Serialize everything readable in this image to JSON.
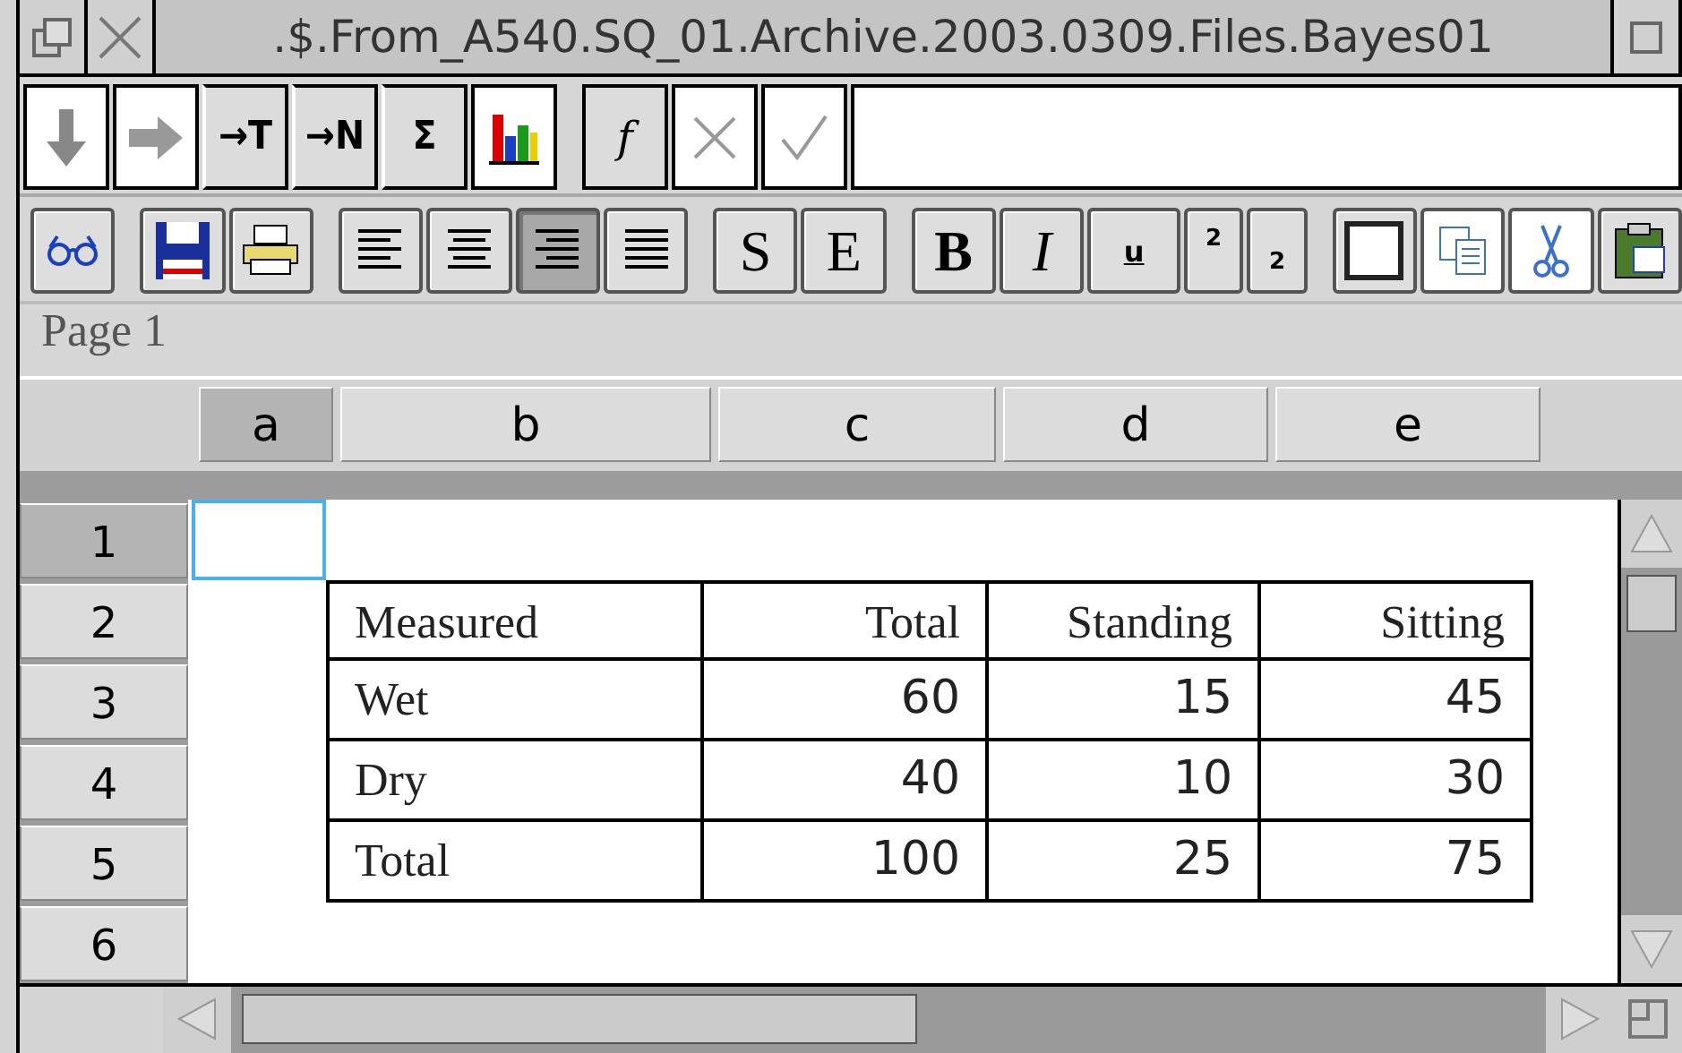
{
  "window": {
    "title": ".$.From_A540.SQ_01.Archive.2003.0309.Files.Bayes01"
  },
  "toolbar_1": [
    {
      "kind": "fill-down"
    },
    {
      "kind": "fill-right"
    },
    {
      "kind": "text",
      "label": "→T"
    },
    {
      "kind": "text",
      "label": "→N"
    },
    {
      "kind": "text",
      "label": "Σ"
    },
    {
      "kind": "chart"
    },
    {
      "kind": "gap"
    },
    {
      "kind": "function",
      "label": "f"
    },
    {
      "kind": "cancel"
    },
    {
      "kind": "accept"
    }
  ],
  "toolbar_2": [
    {
      "kind": "view"
    },
    {
      "kind": "gap"
    },
    {
      "kind": "save"
    },
    {
      "kind": "print"
    },
    {
      "kind": "gap"
    },
    {
      "kind": "align-left",
      "selected": false
    },
    {
      "kind": "align-center",
      "selected": false
    },
    {
      "kind": "align-right",
      "selected": true
    },
    {
      "kind": "justify",
      "selected": false
    },
    {
      "kind": "gap"
    },
    {
      "kind": "text",
      "label": "S"
    },
    {
      "kind": "text",
      "label": "E"
    },
    {
      "kind": "gap"
    },
    {
      "kind": "bold",
      "label": "B"
    },
    {
      "kind": "italic",
      "label": "I"
    },
    {
      "kind": "underline",
      "label": "u"
    },
    {
      "kind": "superscript",
      "label": "2"
    },
    {
      "kind": "subscript",
      "label": "2"
    },
    {
      "kind": "gap"
    },
    {
      "kind": "border"
    },
    {
      "kind": "copy"
    },
    {
      "kind": "cut"
    },
    {
      "kind": "paste"
    }
  ],
  "page_label": "Page 1",
  "sheet": {
    "columns": [
      {
        "label": "a",
        "selected": true
      },
      {
        "label": "b",
        "selected": false
      },
      {
        "label": "c",
        "selected": false
      },
      {
        "label": "d",
        "selected": false
      },
      {
        "label": "e",
        "selected": false
      }
    ],
    "rows": [
      {
        "label": "1",
        "selected": true
      },
      {
        "label": "2",
        "selected": false
      },
      {
        "label": "3",
        "selected": false
      },
      {
        "label": "4",
        "selected": false
      },
      {
        "label": "5",
        "selected": false
      },
      {
        "label": "6",
        "selected": false
      }
    ]
  },
  "table": {
    "rows": [
      [
        "Measured",
        "Total",
        "Standing",
        "Sitting"
      ],
      [
        "Wet",
        "60",
        "15",
        "45"
      ],
      [
        "Dry",
        "40",
        "10",
        "30"
      ],
      [
        "Total",
        "100",
        "25",
        "75"
      ]
    ]
  }
}
